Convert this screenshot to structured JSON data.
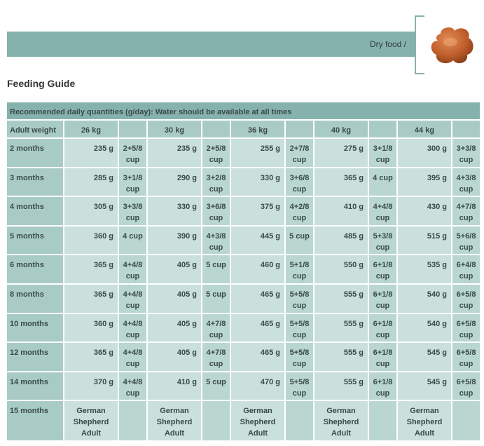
{
  "breadcrumb": "Dry food /",
  "kibble_icon": "dry-kibble-image",
  "page_title": "Feeding Guide",
  "colors": {
    "banner": "#86b2ad",
    "header_row": "#86b2ad",
    "label_cells": "#a9cbc6",
    "gram_cells": "#c9e0dc",
    "cup_cells": "#b9d6d1"
  },
  "table": {
    "caption": "Recommended daily quantities (g/day): Water should be available at all times",
    "weight_label": "Adult weight",
    "weights": [
      "26 kg",
      "30 kg",
      "36 kg",
      "40 kg",
      "44 kg"
    ],
    "rows": [
      {
        "age": "2 months",
        "cells": [
          [
            "235 g",
            "2+5/8 cup"
          ],
          [
            "235 g",
            "2+5/8 cup"
          ],
          [
            "255 g",
            "2+7/8 cup"
          ],
          [
            "275 g",
            "3+1/8 cup"
          ],
          [
            "300 g",
            "3+3/8 cup"
          ]
        ]
      },
      {
        "age": "3 months",
        "cells": [
          [
            "285 g",
            "3+1/8 cup"
          ],
          [
            "290 g",
            "3+2/8 cup"
          ],
          [
            "330 g",
            "3+6/8 cup"
          ],
          [
            "365 g",
            "4 cup"
          ],
          [
            "395 g",
            "4+3/8 cup"
          ]
        ]
      },
      {
        "age": "4 months",
        "cells": [
          [
            "305 g",
            "3+3/8 cup"
          ],
          [
            "330 g",
            "3+6/8 cup"
          ],
          [
            "375 g",
            "4+2/8 cup"
          ],
          [
            "410 g",
            "4+4/8 cup"
          ],
          [
            "430 g",
            "4+7/8 cup"
          ]
        ]
      },
      {
        "age": "5 months",
        "cells": [
          [
            "360 g",
            "4 cup"
          ],
          [
            "390 g",
            "4+3/8 cup"
          ],
          [
            "445 g",
            "5 cup"
          ],
          [
            "485 g",
            "5+3/8 cup"
          ],
          [
            "515 g",
            "5+6/8 cup"
          ]
        ]
      },
      {
        "age": "6 months",
        "cells": [
          [
            "365 g",
            "4+4/8 cup"
          ],
          [
            "405 g",
            "5 cup"
          ],
          [
            "460 g",
            "5+1/8 cup"
          ],
          [
            "550 g",
            "6+1/8 cup"
          ],
          [
            "535 g",
            "6+4/8 cup"
          ]
        ]
      },
      {
        "age": "8 months",
        "cells": [
          [
            "365 g",
            "4+4/8 cup"
          ],
          [
            "405 g",
            "5 cup"
          ],
          [
            "465 g",
            "5+5/8 cup"
          ],
          [
            "555 g",
            "6+1/8 cup"
          ],
          [
            "540 g",
            "6+5/8 cup"
          ]
        ]
      },
      {
        "age": "10 months",
        "cells": [
          [
            "360 g",
            "4+4/8 cup"
          ],
          [
            "405 g",
            "4+7/8 cup"
          ],
          [
            "465 g",
            "5+5/8 cup"
          ],
          [
            "555 g",
            "6+1/8 cup"
          ],
          [
            "540 g",
            "6+5/8 cup"
          ]
        ]
      },
      {
        "age": "12 months",
        "cells": [
          [
            "365 g",
            "4+4/8 cup"
          ],
          [
            "405 g",
            "4+7/8 cup"
          ],
          [
            "465 g",
            "5+5/8 cup"
          ],
          [
            "555 g",
            "6+1/8 cup"
          ],
          [
            "545 g",
            "6+5/8 cup"
          ]
        ]
      },
      {
        "age": "14 months",
        "cells": [
          [
            "370 g",
            "4+4/8 cup"
          ],
          [
            "410 g",
            "5 cup"
          ],
          [
            "470 g",
            "5+5/8 cup"
          ],
          [
            "555 g",
            "6+1/8 cup"
          ],
          [
            "545 g",
            "6+5/8 cup"
          ]
        ]
      }
    ],
    "last_row": {
      "age": "15 months",
      "switch_text": "German Shepherd Adult"
    }
  }
}
